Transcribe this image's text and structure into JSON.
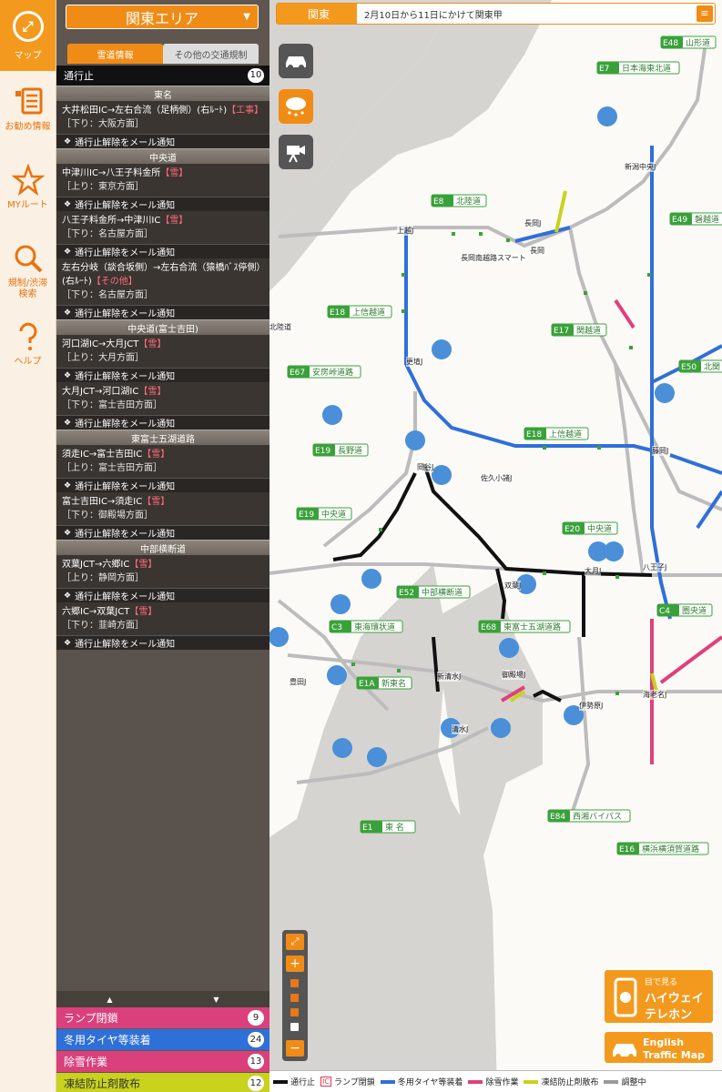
{
  "nav": {
    "map_label": "マップ",
    "items": [
      {
        "label": "お勧め情報",
        "icon": "list-icon"
      },
      {
        "label": "MYルート",
        "icon": "star-icon"
      },
      {
        "label": "規制/渋滞\n検索",
        "icon": "search-icon"
      },
      {
        "label": "ヘルプ",
        "icon": "help-icon"
      }
    ]
  },
  "panel": {
    "area_select": "関東エリア",
    "tabs": [
      "雪道情報",
      "その他の交通規制"
    ],
    "stop_header": "通行止",
    "stop_count": "10",
    "groups": [
      {
        "road": "東名",
        "entries": [
          {
            "route": "大井松田IC→左右合流（足柄側）(右ﾙｰﾄ)",
            "tag": "【工事】",
            "dir": "［下り：大阪方面］"
          }
        ]
      },
      {
        "road": "中央道",
        "entries": [
          {
            "route": "中津川IC→八王子料金所",
            "tag": "【雪】",
            "dir": "［上り：東京方面］"
          },
          {
            "route": "八王子料金所→中津川IC",
            "tag": "【雪】",
            "dir": "［下り：名古屋方面］"
          },
          {
            "route": "左右分岐（談合坂側）→左右合流（猿橋ﾊﾞｽ停側）(右ﾙｰﾄ)",
            "tag": "【その他】",
            "dir": "［下り：名古屋方面］"
          }
        ]
      },
      {
        "road": "中央道(富士吉田)",
        "entries": [
          {
            "route": "河口湖IC→大月JCT",
            "tag": "【雪】",
            "dir": "［上り：大月方面］"
          },
          {
            "route": "大月JCT→河口湖IC",
            "tag": "【雪】",
            "dir": "［下り：富士吉田方面］"
          }
        ]
      },
      {
        "road": "東富士五湖道路",
        "entries": [
          {
            "route": "須走IC→富士吉田IC",
            "tag": "【雪】",
            "dir": "［上り：富士吉田方面］"
          },
          {
            "route": "富士吉田IC→須走IC",
            "tag": "【雪】",
            "dir": "［下り：御殿場方面］"
          }
        ]
      },
      {
        "road": "中部横断道",
        "entries": [
          {
            "route": "双葉JCT→六郷IC",
            "tag": "【雪】",
            "dir": "［上り：静岡方面］"
          },
          {
            "route": "六郷IC→双葉JCT",
            "tag": "【雪】",
            "dir": "［下り：韮崎方面］"
          }
        ]
      }
    ],
    "mail_label": "通行止解除をメール通知",
    "pager_up": "▲",
    "pager_down": "▼",
    "legend_rows": [
      {
        "label": "ランプ閉鎖",
        "count": "9",
        "color": "#e0407a"
      },
      {
        "label": "冬用タイヤ等装着",
        "count": "24",
        "color": "#2f6fd8"
      },
      {
        "label": "除雪作業",
        "count": "13",
        "color": "#e0407a"
      },
      {
        "label": "凍結防止剤散布",
        "count": "12",
        "color": "#c9d21c"
      }
    ]
  },
  "topbar": {
    "region": "関東",
    "message": "2月10日から11日にかけて関東甲",
    "menu_icon": "≡"
  },
  "map": {
    "route_labels": [
      {
        "code": "E48",
        "name": "山形道"
      },
      {
        "code": "E7",
        "name": "日本海東北道"
      },
      {
        "code": "E8",
        "name": "北陸道"
      },
      {
        "code": "E49",
        "name": "磐越道"
      },
      {
        "code": "E18",
        "name": "上信越道"
      },
      {
        "code": "E17",
        "name": "関越道"
      },
      {
        "code": "E50",
        "name": "北関"
      },
      {
        "code": "E67",
        "name": "安房峠道路"
      },
      {
        "code": "E18",
        "name": "上信越道"
      },
      {
        "code": "E19",
        "name": "長野道"
      },
      {
        "code": "E19",
        "name": "中央道"
      },
      {
        "code": "E20",
        "name": "中央道"
      },
      {
        "code": "E52",
        "name": "中部横断道"
      },
      {
        "code": "C3",
        "name": "東海環状道"
      },
      {
        "code": "E68",
        "name": "東富士五湖道路"
      },
      {
        "code": "C4",
        "name": "圏央道"
      },
      {
        "code": "E1A",
        "name": "新東名"
      },
      {
        "code": "E1",
        "name": "東 名"
      },
      {
        "code": "E84",
        "name": "西湘バイパス"
      },
      {
        "code": "E16",
        "name": "横浜横須賀道路"
      }
    ],
    "place_labels": [
      "北陸道",
      "新潟中央J",
      "長岡J",
      "長岡",
      "上越J",
      "更埴J",
      "岡谷J",
      "八王子J",
      "海老名J",
      "伊勢原J",
      "御殿場J",
      "清水J",
      "新清水J",
      "豊田J",
      "双葉J",
      "大月J",
      "長岡南越路スマート",
      "藤岡J",
      "佐久小諸J"
    ],
    "zoom_in": "+",
    "zoom_out": "−",
    "zoom_fit_icon": "expand-icon"
  },
  "promos": [
    {
      "line1": "目で見る",
      "line2": "ハイウェイ",
      "line3": "テレホン"
    },
    {
      "line1": "English",
      "line2": "Traffic Map"
    }
  ],
  "map_legend": [
    {
      "label": "通行止",
      "color": "#111111"
    },
    {
      "label": "ランプ閉鎖",
      "badge": "IC"
    },
    {
      "label": "冬用タイヤ等装着",
      "color": "#2f6fd8"
    },
    {
      "label": "除雪作業",
      "color": "#e0407a"
    },
    {
      "label": "凍結防止剤散布",
      "color": "#c9d21c"
    },
    {
      "label": "調整中",
      "color": "#999999"
    }
  ],
  "colors": {
    "accent": "#f08c16",
    "stop": "#111111",
    "winter_tire": "#2f6fd8",
    "snow_removal": "#e0407a",
    "antifreeze": "#c9d21c"
  }
}
